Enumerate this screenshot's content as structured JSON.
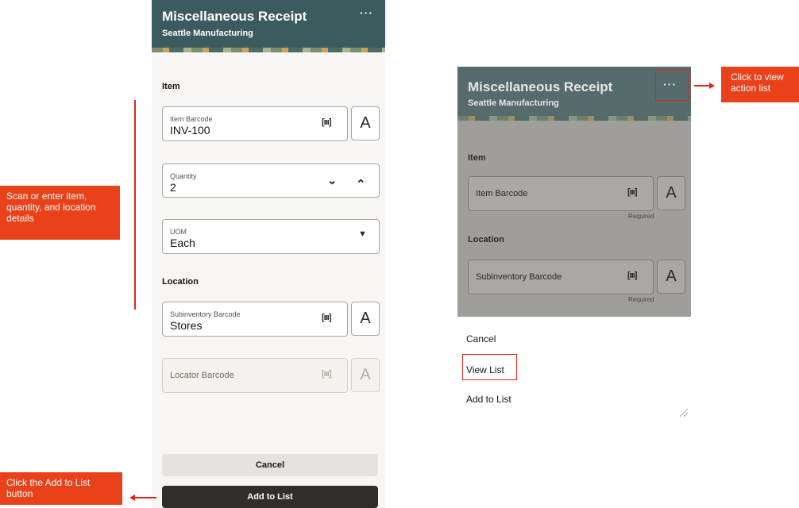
{
  "left_screen": {
    "header": {
      "title": "Miscellaneous Receipt",
      "subtitle": "Seattle Manufacturing",
      "more_icon": "ellipsis-icon"
    },
    "item_section": "Item",
    "item_barcode": {
      "label": "Item Barcode",
      "value": "INV-100"
    },
    "quantity": {
      "label": "Quantity",
      "value": "2"
    },
    "uom": {
      "label": "UOM",
      "value": "Each"
    },
    "location_section": "Location",
    "subinventory": {
      "label": "Subinventory Barcode",
      "value": "Stores"
    },
    "locator": {
      "placeholder": "Locator Barcode"
    },
    "buttons": {
      "cancel": "Cancel",
      "add_to_list": "Add to List"
    }
  },
  "right_screen": {
    "header": {
      "title": "Miscellaneous Receipt",
      "subtitle": "Seattle Manufacturing"
    },
    "item_section": "Item",
    "item_barcode": {
      "placeholder": "Item Barcode",
      "hint": "Required"
    },
    "location_section": "Location",
    "subinventory": {
      "placeholder": "Subinventory Barcode",
      "hint": "Required"
    },
    "action_menu": [
      "Cancel",
      "View List",
      "Add to List"
    ]
  },
  "callouts": {
    "scan": "Scan or enter item, quantity, and location details",
    "add": "Click the Add to List button",
    "action": "Click to view action list"
  },
  "colors": {
    "header": "#3b5b5e",
    "accent": "#e9421b",
    "primary_button": "#312d2a"
  }
}
